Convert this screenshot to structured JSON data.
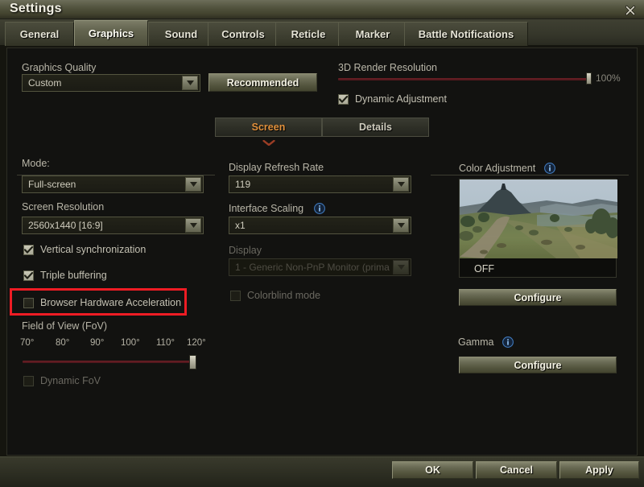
{
  "window": {
    "title": "Settings",
    "close_icon": "close-icon"
  },
  "tabs": [
    {
      "label": "General",
      "active": false
    },
    {
      "label": "Graphics",
      "active": true
    },
    {
      "label": "Sound",
      "active": false
    },
    {
      "label": "Controls",
      "active": false
    },
    {
      "label": "Reticle",
      "active": false
    },
    {
      "label": "Marker",
      "active": false
    },
    {
      "label": "Battle Notifications",
      "active": false
    }
  ],
  "graphics_quality": {
    "label": "Graphics Quality",
    "value": "Custom",
    "recommended_button": "Recommended"
  },
  "render_resolution": {
    "label": "3D Render Resolution",
    "value": "100%",
    "dynamic_adjustment_label": "Dynamic Adjustment",
    "dynamic_adjustment_checked": true
  },
  "subtabs": [
    {
      "label": "Screen",
      "active": true
    },
    {
      "label": "Details",
      "active": false
    }
  ],
  "left_column": {
    "mode_label": "Mode:",
    "mode_value": "Full-screen",
    "resolution_label": "Screen Resolution",
    "resolution_value": "2560x1440 [16:9]",
    "vsync_label": "Vertical synchronization",
    "vsync_checked": true,
    "triple_buffering_label": "Triple buffering",
    "triple_buffering_checked": true,
    "browser_accel_label": "Browser Hardware Acceleration",
    "browser_accel_checked": false,
    "fov_label": "Field of View (FoV)",
    "fov_ticks": [
      "70°",
      "80°",
      "90°",
      "100°",
      "110°",
      "120°"
    ],
    "dynamic_fov_label": "Dynamic FoV",
    "dynamic_fov_checked": false
  },
  "middle_column": {
    "refresh_rate_label": "Display Refresh Rate",
    "refresh_rate_value": "119",
    "interface_scaling_label": "Interface Scaling",
    "interface_scaling_value": "x1",
    "display_label": "Display",
    "display_value": "1 - Generic Non-PnP Monitor (prima",
    "colorblind_label": "Colorblind mode",
    "colorblind_checked": false
  },
  "right_column": {
    "color_adjustment_label": "Color Adjustment",
    "preview_state": "OFF",
    "color_configure_button": "Configure",
    "gamma_label": "Gamma",
    "gamma_configure_button": "Configure"
  },
  "footer_buttons": {
    "ok": "OK",
    "cancel": "Cancel",
    "apply": "Apply"
  },
  "colors": {
    "accent_orange": "#e0903c",
    "highlight_red": "#ee1c24",
    "slider_red": "#6e2026",
    "panel_bg": "#121210",
    "info_blue": "#1d4f86"
  }
}
